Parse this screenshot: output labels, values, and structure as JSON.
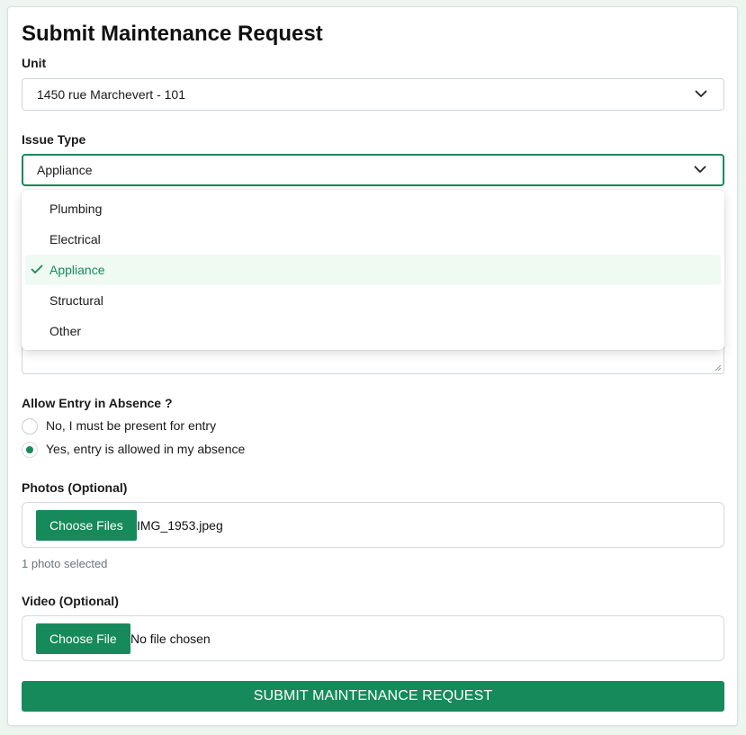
{
  "form": {
    "title": "Submit Maintenance Request",
    "unit": {
      "label": "Unit",
      "value": "1450 rue Marchevert - 101"
    },
    "issue_type": {
      "label": "Issue Type",
      "value": "Appliance",
      "options": [
        "Plumbing",
        "Electrical",
        "Appliance",
        "Structural",
        "Other"
      ],
      "selected_index": 2
    },
    "entry": {
      "label": "Allow Entry in Absence ?",
      "options": [
        {
          "label": "No, I must be present for entry",
          "checked": false
        },
        {
          "label": "Yes, entry is allowed in my absence",
          "checked": true
        }
      ]
    },
    "photos": {
      "label": "Photos (Optional)",
      "button": "Choose Files",
      "file_name": "IMG_1953.jpeg",
      "helper": "1 photo selected"
    },
    "video": {
      "label": "Video (Optional)",
      "button": "Choose File",
      "file_name": "No file chosen"
    },
    "submit_label": "SUBMIT MAINTENANCE REQUEST"
  },
  "colors": {
    "accent": "#168a5a",
    "page_background": "#ecf6ef",
    "selected_option_bg": "#effaf3"
  },
  "icons": {
    "select_arrow": "chevron-down-icon",
    "selected_option": "checkmark-icon",
    "textarea_resize": "resize-handle-icon"
  }
}
